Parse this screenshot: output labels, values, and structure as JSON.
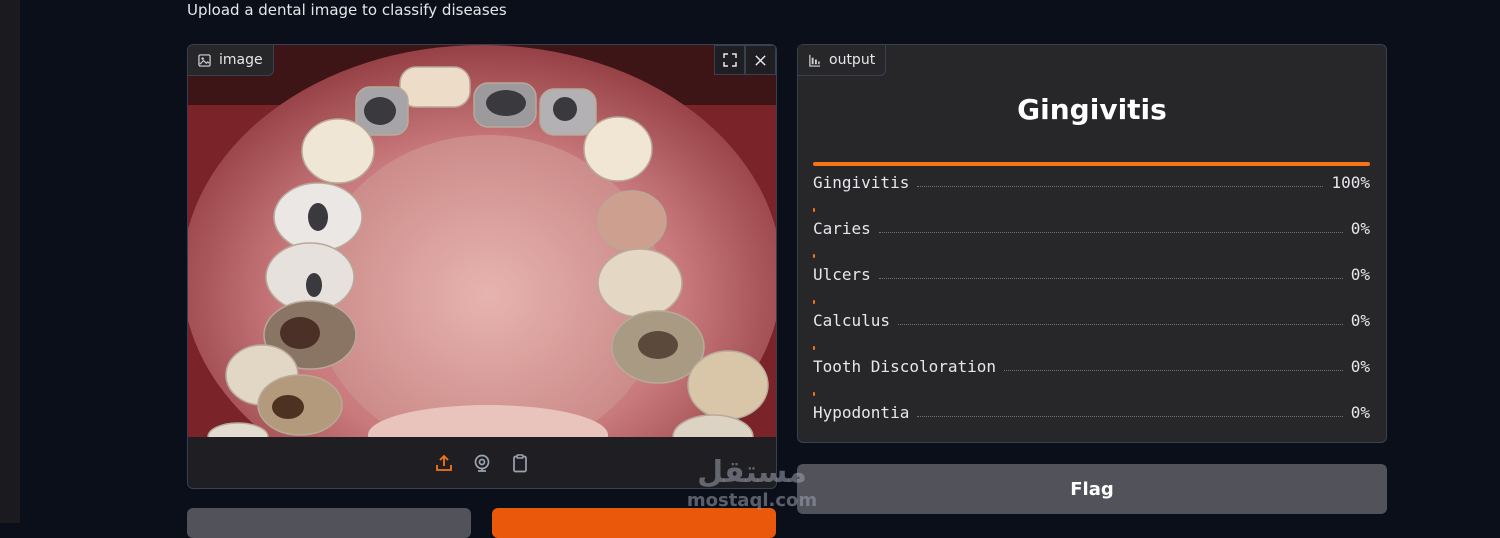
{
  "description": "Upload a dental image to classify diseases",
  "input_panel": {
    "label": "image",
    "icon": "image-icon",
    "toolbar_icons": [
      "upload-icon",
      "webcam-icon",
      "clipboard-icon"
    ],
    "accent_color": "#f97316"
  },
  "output_panel": {
    "label": "output",
    "icon": "bar-chart-icon",
    "top_label": "Gingivitis",
    "confidences": [
      {
        "label": "Gingivitis",
        "value": "100%",
        "fraction": 1.0
      },
      {
        "label": "Caries",
        "value": "0%",
        "fraction": 0.0
      },
      {
        "label": "Ulcers",
        "value": "0%",
        "fraction": 0.0
      },
      {
        "label": "Calculus",
        "value": "0%",
        "fraction": 0.0
      },
      {
        "label": "Tooth Discoloration",
        "value": "0%",
        "fraction": 0.0
      },
      {
        "label": "Hypodontia",
        "value": "0%",
        "fraction": 0.0
      }
    ]
  },
  "buttons": {
    "flag": "Flag"
  },
  "watermark": {
    "arabic": "مستقل",
    "latin": "mostaql.com"
  },
  "colors": {
    "background": "#0b0f19",
    "panel": "#27272a",
    "accent": "#f97316",
    "primary_button": "#ea580c",
    "secondary_button": "#52525b"
  }
}
